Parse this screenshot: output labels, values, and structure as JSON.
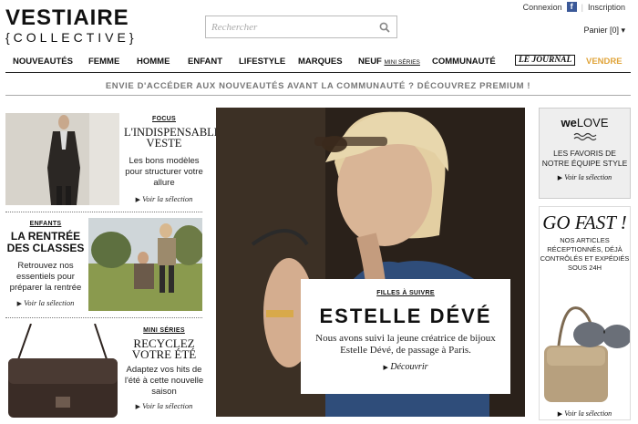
{
  "header": {
    "logo_line1": "VESTIAIRE",
    "logo_line2": "{COLLECTIVE}",
    "search_placeholder": "Rechercher",
    "login": "Connexion",
    "signup": "Inscription",
    "cart": "Panier [0] ▾"
  },
  "nav": {
    "items": [
      "NOUVEAUTÉS",
      "FEMME",
      "HOMME",
      "ENFANT",
      "LIFESTYLE",
      "MARQUES"
    ],
    "neuf": "NEUF",
    "neuf_sub": "MINI SÉRIES",
    "communaute": "COMMUNAUTÉ",
    "journal": "LE JOURNAL",
    "vendre": "VENDRE"
  },
  "promo": "ENVIE D'ACCÉDER AUX NOUVEAUTÉS AVANT LA COMMUNAUTÉ ? DÉCOUVREZ PREMIUM !",
  "focus": {
    "tag": "FOCUS",
    "title": "L'INDISPENSABLE VESTE",
    "desc": "Les bons modèles pour structurer votre allure",
    "more": "Voir la sélection"
  },
  "enfants": {
    "tag": "ENFANTS",
    "title": "LA RENTRÉE DES CLASSES",
    "desc": "Retrouvez nos essentiels pour préparer la rentrée",
    "more": "Voir la sélection"
  },
  "mini": {
    "tag": "MINI SÉRIES",
    "title": "RECYCLEZ VOTRE ÉTÉ",
    "desc": "Adaptez vos hits de l'été à cette nouvelle saison",
    "more": "Voir la sélection"
  },
  "hero": {
    "tag": "FILLES À SUIVRE",
    "title": "ESTELLE DÉVÉ",
    "desc": "Nous avons suivi la jeune créatrice de bijoux Estelle Dévé, de passage à Paris.",
    "more": "Découvrir"
  },
  "welove": {
    "title_pre": "we",
    "title_post": "LOVE",
    "desc": "LES FAVORIS DE NOTRE ÉQUIPE STYLE",
    "more": "Voir la sélection"
  },
  "gofast": {
    "title": "GO FAST !",
    "desc": "NOS ARTICLES RÉCEPTIONNÉS, DÉJÀ CONTRÔLÉS ET EXPÉDIÉS SOUS 24H",
    "more": "Voir la sélection"
  },
  "colors": {
    "accent_vendre": "#e0a43a",
    "facebook": "#3b5998"
  }
}
